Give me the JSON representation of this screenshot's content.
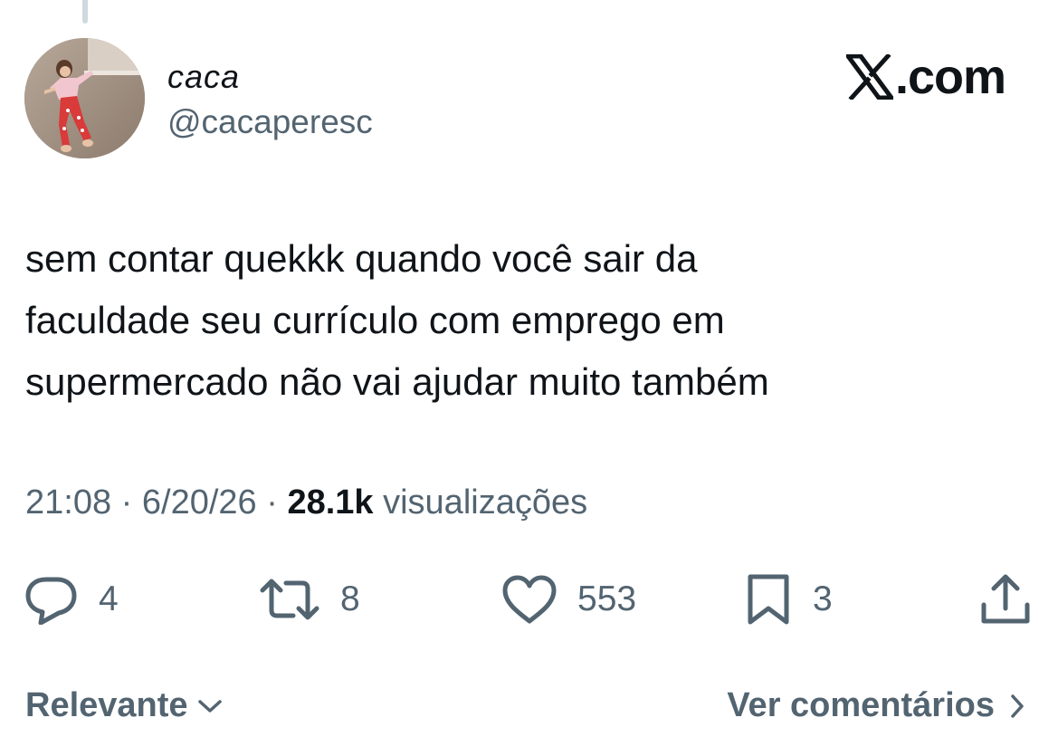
{
  "author": {
    "name": "caca",
    "handle": "@cacaperesc"
  },
  "brand": {
    "text": ".com"
  },
  "tweet": {
    "lines": [
      "sem contar quekkk quando você sair da",
      "faculdade seu currículo com emprego em",
      "supermercado não vai ajudar muito também"
    ]
  },
  "meta": {
    "time": "21:08",
    "separator": "·",
    "date": "6/20/26",
    "views_count": "28.1k",
    "views_label": "visualizações"
  },
  "actions": {
    "replies": "4",
    "retweets": "8",
    "likes": "553",
    "bookmarks": "3"
  },
  "footer": {
    "sort_label": "Relevante",
    "comments_link": "Ver comentários"
  },
  "icons": [
    "reply-icon",
    "retweet-icon",
    "heart-icon",
    "bookmark-icon",
    "share-icon",
    "chevron-down-icon",
    "chevron-right-icon",
    "x-logo-icon"
  ],
  "colors": {
    "text": "#0f1419",
    "secondary": "#536471",
    "thread_line": "#cfd9de"
  }
}
